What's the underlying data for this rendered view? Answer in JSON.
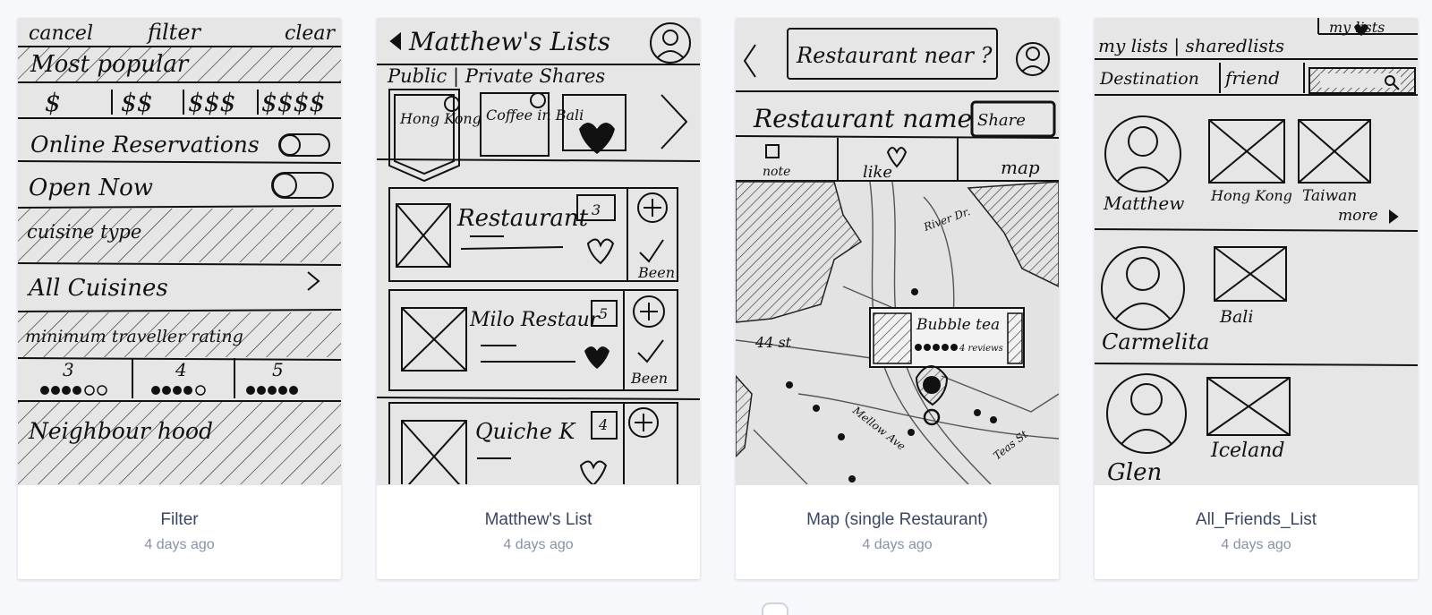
{
  "cards": [
    {
      "title": "Filter",
      "time": "4 days ago",
      "sketch": {
        "header_left": "cancel",
        "header_center": "filter",
        "header_right": "clear",
        "section_popular": "Most popular",
        "prices": [
          "$",
          "$$",
          "$$$",
          "$$$$"
        ],
        "toggle_online": "Online Reservations",
        "toggle_open": "Open Now",
        "cuisine_label": "cuisine type",
        "cuisine_value": "All Cuisines",
        "rating_label": "minimum traveller rating",
        "ratings": [
          "3",
          "4",
          "5"
        ],
        "neighbourhood": "Neighbour hood"
      }
    },
    {
      "title": "Matthew's List",
      "time": "4 days ago",
      "sketch": {
        "header": "Matthew's Lists",
        "tabs": "Public | Private Shares",
        "lists": [
          "Hong Kong",
          "Coffee in Bali"
        ],
        "items": [
          {
            "name": "Restaurant",
            "rank": "3",
            "status": "Been"
          },
          {
            "name": "Milo Restaur",
            "rank": "5",
            "status": "Been"
          },
          {
            "name": "Quiche K",
            "rank": "4",
            "status": ""
          }
        ]
      }
    },
    {
      "title": "Map (single Restaurant)",
      "time": "4 days ago",
      "sketch": {
        "search": "Restaurant near ?",
        "restaurant_name": "Restaurant name",
        "share": "Share",
        "actions": [
          "note",
          "like",
          "map"
        ],
        "street_labels": [
          "44 st",
          "Mellow Ave",
          "Teas St",
          "River Dr."
        ],
        "popup_name": "Bubble tea",
        "popup_reviews": "4 reviews"
      }
    },
    {
      "title": "All_Friends_List",
      "time": "4 days ago",
      "sketch": {
        "top_right": "my lists",
        "tabs": "my lists | sharedlists",
        "filters": [
          "Destination",
          "friend"
        ],
        "friends": [
          {
            "name": "Matthew",
            "lists": [
              "Hong Kong",
              "Taiwan"
            ],
            "more": "more"
          },
          {
            "name": "Carmelita",
            "lists": [
              "Bali"
            ]
          },
          {
            "name": "Glen",
            "lists": [
              "Iceland"
            ]
          }
        ]
      }
    }
  ],
  "colors": {
    "page_bg": "#f7f8fb",
    "title_text": "#3b4660",
    "meta_text": "#8892a6",
    "sketch_bg": "#e6e6e6"
  }
}
